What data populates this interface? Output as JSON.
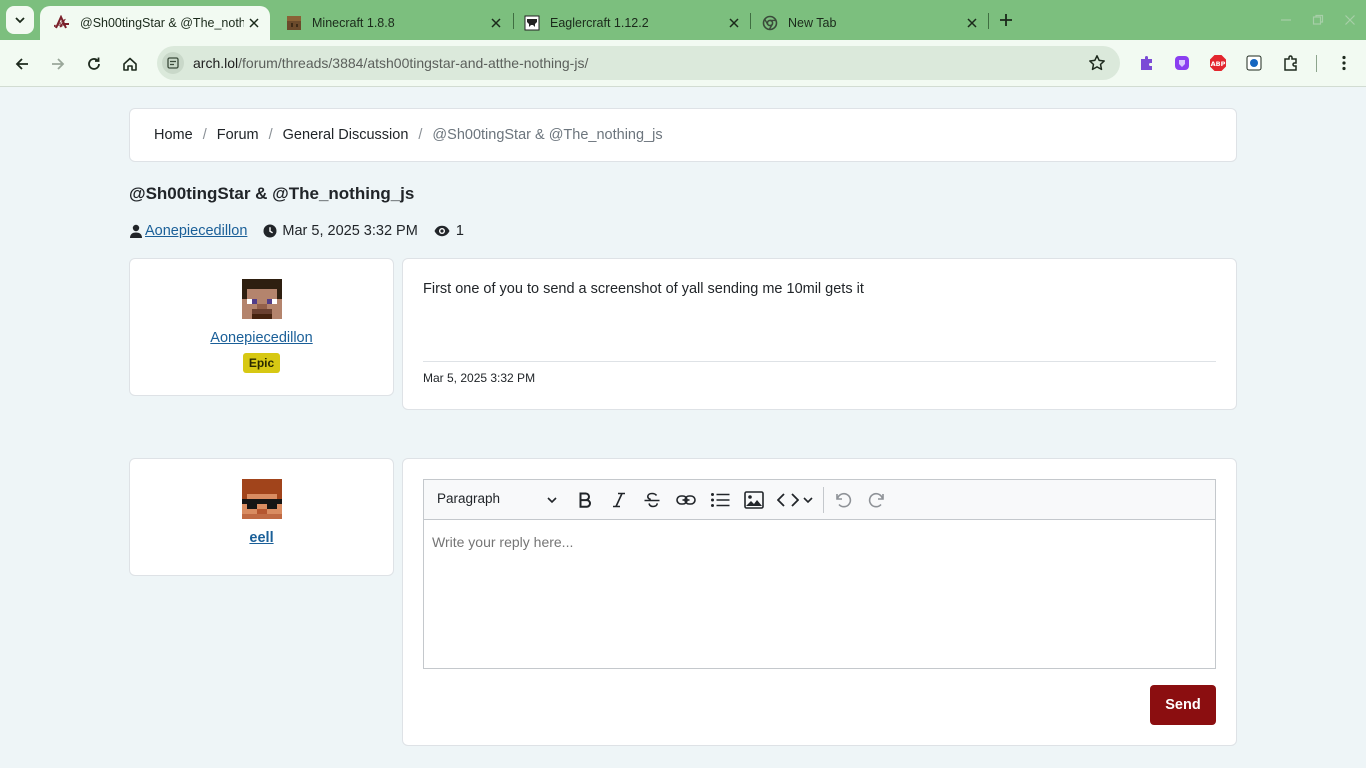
{
  "browser": {
    "tabs": [
      {
        "title": "@Sh00tingStar & @The_nothing_js",
        "active": true,
        "icon": "arch-favicon"
      },
      {
        "title": "Minecraft 1.8.8",
        "active": false,
        "icon": "minecraft-block-favicon"
      },
      {
        "title": "Eaglercraft 1.12.2",
        "active": false,
        "icon": "eaglercraft-favicon"
      },
      {
        "title": "New Tab",
        "active": false,
        "icon": "chrome-favicon"
      }
    ],
    "url_host": "arch.lol",
    "url_path": "/forum/threads/3884/atsh00tingstar-and-atthe-nothing-js/",
    "extensions": [
      "puzzle-extension-icon",
      "shield-extension-icon",
      "adblock-extension-icon",
      "screen-extension-icon",
      "extensions-icon"
    ],
    "colors": {
      "frame": "#7cbf7e",
      "toolbar": "#f2faf2",
      "omnibox": "#dbe9db"
    }
  },
  "breadcrumb": {
    "home": "Home",
    "forum": "Forum",
    "category": "General Discussion",
    "current": "@Sh00tingStar & @The_nothing_js"
  },
  "thread": {
    "title": "@Sh00tingStar & @The_nothing_js",
    "author": "Aonepiecedillon",
    "date": "Mar 5, 2025 3:32 PM",
    "views": "1"
  },
  "post": {
    "author": "Aonepiecedillon",
    "rank": "Epic",
    "body": "First one of you to send a screenshot of yall sending me 10mil gets it",
    "date": "Mar 5, 2025 3:32 PM"
  },
  "reply": {
    "user": "eell",
    "format_label": "Paragraph",
    "placeholder": "Write your reply here...",
    "send_label": "Send"
  },
  "colors": {
    "link": "#1a5f98",
    "badge": "#d7c813",
    "send": "#8b0e10",
    "page_bg": "#eef5f7"
  }
}
